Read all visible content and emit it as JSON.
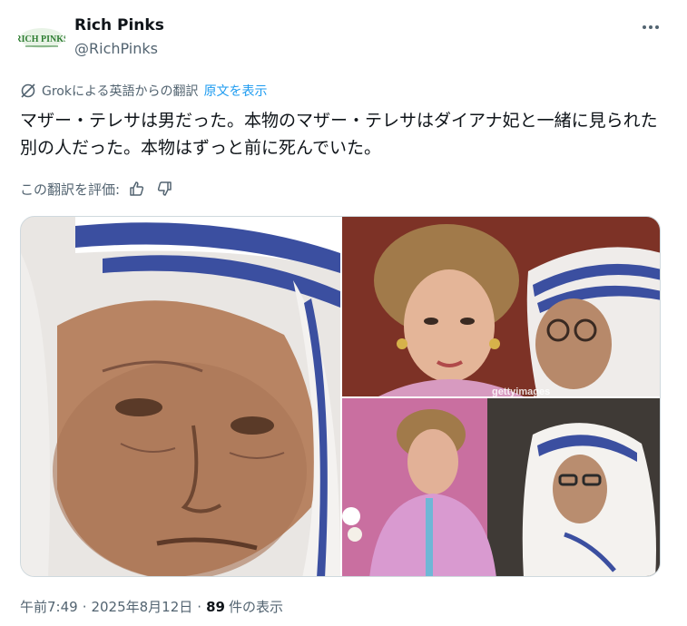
{
  "user": {
    "display_name": "Rich Pinks",
    "handle": "@RichPinks",
    "avatar_text": "RICH PINKS"
  },
  "translation": {
    "source_label": "Grokによる英語からの翻訳",
    "show_original": "原文を表示"
  },
  "tweet": {
    "text": "マザー・テレサは男だった。本物のマザー・テレサはダイアナ妃と一緒に見られた別の人だった。本物はずっと前に死んでいた。"
  },
  "rating": {
    "label": "この翻訳を評価:"
  },
  "media": {
    "watermark": "gettyimages"
  },
  "footer": {
    "time": "午前7:49",
    "date": "2025年8月12日",
    "views": "89",
    "views_label": "件の表示"
  },
  "icons": {
    "more": "more-horizontal-icon",
    "grok": "grok-icon",
    "thumbs_up": "thumbs-up-icon",
    "thumbs_down": "thumbs-down-icon"
  },
  "colors": {
    "link": "#1d9bf0",
    "secondary_text": "#536471",
    "primary_text": "#0f1419",
    "habit_blue": "#3b4fa0"
  }
}
